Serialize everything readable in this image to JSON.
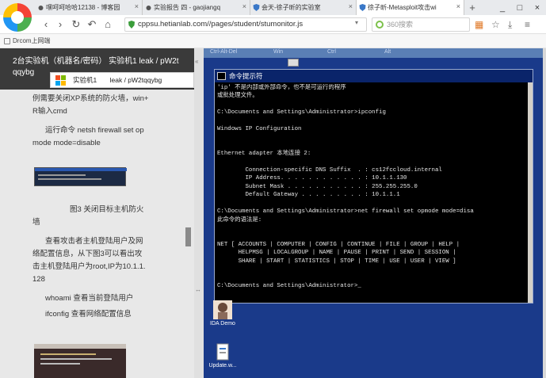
{
  "browser": {
    "tabs": [
      {
        "title": "嘿呵呵哈哈12138 - 博客园"
      },
      {
        "title": "实验报告 四 - gaojiangq"
      },
      {
        "title": "会天-徐子昕的实验室"
      },
      {
        "title": "徐子昕-Metasploit攻击wi"
      }
    ],
    "new_tab": "+",
    "window_controls": [
      "_",
      "□",
      "×"
    ],
    "url": "cppsu.hetianlab.com//pages/student/stumonitor.js",
    "search_placeholder": "360搜索",
    "bookmark": "Drcom上网端"
  },
  "left_panel": {
    "header_line1": "2台实验机（机器名/密码）  实验机1  leak / pW2t",
    "header_line2": "qqybg",
    "tooltip_label": "实验机1",
    "tooltip_value": "leak / pW2tqqybg",
    "para1_line1": "例需要关闭XP系统的防火墙，win+",
    "para1_line2": "R输入cmd",
    "para2_line1": "运行命令 netsh firewall set op",
    "para2_line2": "mode mode=disable",
    "fig_caption_line1": "图3 关闭目标主机防火",
    "fig_caption_line2": "墙",
    "para3_line1": "查看攻击者主机登陆用户及网",
    "para3_line2": "络配置信息，从下图3可以看出攻",
    "para3_line3": "击主机登陆用户为root,IP为10.1.1.",
    "para3_line4": "128",
    "cmd_whoami": "whoami 查看当前登陆用户",
    "cmd_ifconfig": "ifconfig 查看网络配置信息"
  },
  "remote": {
    "top_bar": [
      "Ctrl-Alt-Del",
      "Win",
      "Ctrl",
      "Alt"
    ],
    "cmd_title": "命令提示符",
    "cmd_output": "'ip' 不是内部或外部命令，也不是可运行的程序\n或批处理文件。\n\nC:\\Documents and Settings\\Administrator>ipconfig\n\nWindows IP Configuration\n\n\nEthernet adapter 本地连接 2:\n\n        Connection-specific DNS Suffix  . : cs12fccloud.internal\n        IP Address. . . . . . . . . . . . : 10.1.1.130\n        Subnet Mask . . . . . . . . . . . : 255.255.255.0\n        Default Gateway . . . . . . . . . : 10.1.1.1\n\nC:\\Documents and Settings\\Administrator>net firewall set opmode mode=disa\n此命令的语法是:\n\n\nNET [ ACCOUNTS | COMPUTER | CONFIG | CONTINUE | FILE | GROUP | HELP |\n      HELPMSG | LOCALGROUP | NAME | PAUSE | PRINT | SEND | SESSION |\n      SHARE | START | STATISTICS | STOP | TIME | USE | USER | VIEW ]\n\n\nC:\\Documents and Settings\\Administrator>_",
    "desktop_icons": [
      {
        "label": "IDA Demo"
      },
      {
        "label": "Update.w..."
      }
    ]
  }
}
